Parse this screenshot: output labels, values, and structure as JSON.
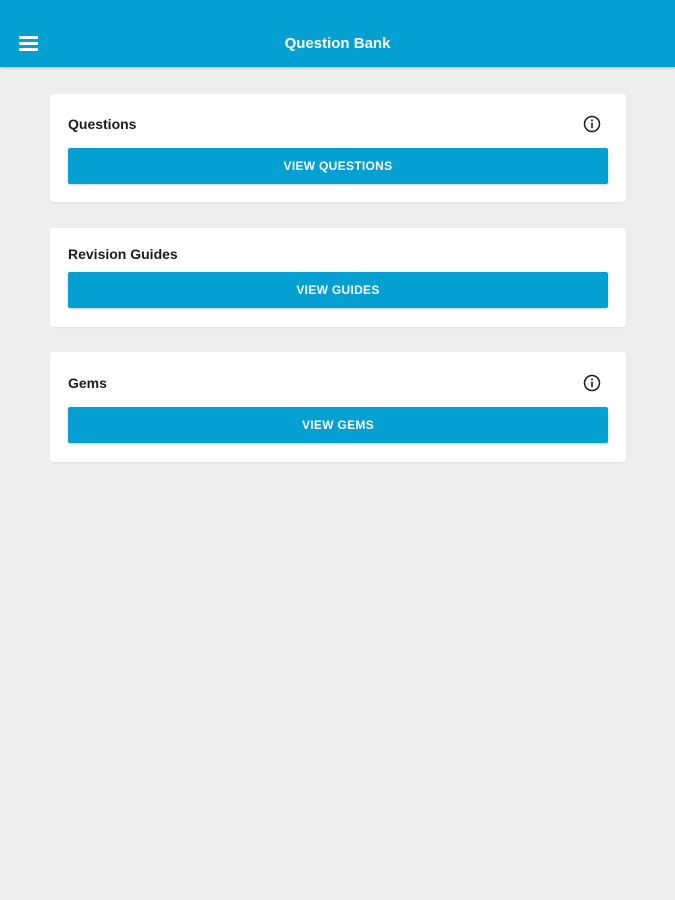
{
  "header": {
    "title": "Question Bank",
    "menu_icon": "hamburger-menu-icon",
    "background": "#04a0d2"
  },
  "cards": [
    {
      "title": "Questions",
      "button_label": "VIEW QUESTIONS",
      "has_info_icon": true
    },
    {
      "title": "Revision Guides",
      "button_label": "VIEW GUIDES",
      "has_info_icon": false
    },
    {
      "title": "Gems",
      "button_label": "VIEW GEMS",
      "has_info_icon": true
    }
  ],
  "colors": {
    "accent": "#04a0d2",
    "page_background": "#eeeeee",
    "card_background": "#ffffff"
  }
}
